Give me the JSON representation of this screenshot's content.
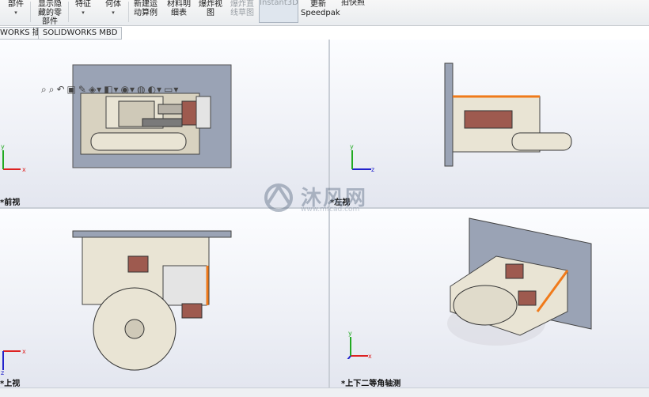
{
  "ribbon": {
    "buttons": [
      {
        "label": "部件",
        "caret": "▾"
      },
      {
        "label": "显示隐\n藏的零\n部件",
        "caret": ""
      },
      {
        "label": "特征",
        "caret": "▾"
      },
      {
        "label": "何体",
        "caret": "▾"
      },
      {
        "label": "新建运\n动算例",
        "caret": ""
      },
      {
        "label": "材料明\n细表",
        "caret": ""
      },
      {
        "label": "爆炸视\n图",
        "caret": ""
      },
      {
        "label": "爆炸直\n线草图",
        "caret": ""
      },
      {
        "label": "Instant3D",
        "caret": ""
      },
      {
        "label": "更新\nSpeedpak",
        "caret": ""
      },
      {
        "label": "拍快照",
        "caret": ""
      }
    ]
  },
  "tabs": [
    "WORKS 插件",
    "SOLIDWORKS MBD"
  ],
  "toolbar_icons": [
    "zoom-to-fit-icon",
    "zoom-area-icon",
    "previous-view-icon",
    "section-view-icon",
    "dynamic-annotation-icon",
    "view-orientation-icon",
    "display-style-icon",
    "hide-show-icon",
    "edit-appearance-icon",
    "apply-scene-icon",
    "display-settings-icon"
  ],
  "viewports": {
    "front": {
      "label": "*前视"
    },
    "left": {
      "label": "*左视"
    },
    "top": {
      "label": "*上视"
    },
    "iso": {
      "label": "*上下二等角轴测"
    }
  },
  "triad": {
    "x": "x",
    "y": "y",
    "z": "z"
  },
  "watermark": {
    "text": "沐风网",
    "url": "www.mfcad.com"
  },
  "colors": {
    "accent_orange": "#f07a1a",
    "axis_red": "#d22",
    "axis_green": "#2a2",
    "axis_blue": "#22c"
  }
}
